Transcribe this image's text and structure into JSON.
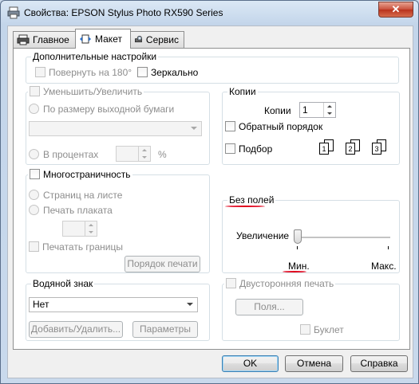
{
  "window": {
    "title": "Свойства: EPSON Stylus Photo RX590 Series",
    "close_glyph": "✕"
  },
  "tabs": [
    {
      "label": "Главное",
      "icon": "printer-icon"
    },
    {
      "label": "Макет",
      "icon": "layout-icon",
      "active": true
    },
    {
      "label": "Сервис",
      "icon": "service-icon"
    }
  ],
  "extra_settings": {
    "title": "Дополнительные настройки",
    "rotate_label": "Повернуть на 180°",
    "mirror_label": "Зеркально"
  },
  "reduce_enlarge": {
    "title": "Уменьшить/Увеличить",
    "fit_page_label": "По размеру выходной бумаги",
    "paper_value": "",
    "percent_label": "В процентах",
    "percent_value": "",
    "percent_sign": "%"
  },
  "copies": {
    "title": "Копии",
    "copies_label": "Копии",
    "copies_value": "1",
    "reverse_label": "Обратный порядок",
    "collate_label": "Подбор",
    "collate_icons": [
      "1",
      "2",
      "3"
    ]
  },
  "multipage": {
    "title": "Многостраничность",
    "pages_per_sheet_label": "Страниц на листе",
    "poster_label": "Печать плаката",
    "print_borders_label": "Печатать границы",
    "print_order_button": "Порядок печати"
  },
  "borderless": {
    "title": "Без полей",
    "enlargement_label": "Увеличение",
    "min_label": "Мин.",
    "max_label": "Макс.",
    "slider_value_fraction": 0.0
  },
  "watermark": {
    "title": "Водяной знак",
    "selected": "Нет",
    "add_remove_button": "Добавить/Удалить...",
    "parameters_button": "Параметры"
  },
  "duplex": {
    "title": "Двусторонняя печать",
    "margins_button": "Поля...",
    "booklet_label": "Буклет"
  },
  "footer": {
    "ok": "OK",
    "cancel": "Отмена",
    "help": "Справка"
  },
  "colors": {
    "annotation_underline": "#e0001a",
    "disabled_text": "#8d8d8d"
  }
}
